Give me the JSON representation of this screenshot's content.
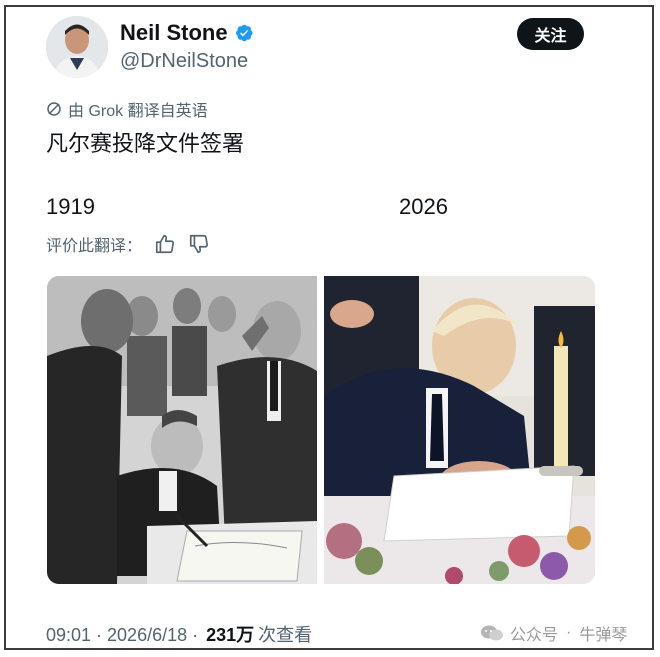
{
  "author": {
    "display_name": "Neil Stone",
    "handle": "@DrNeilStone",
    "verified_icon": "verified-badge-icon"
  },
  "follow_button": {
    "label": "关注"
  },
  "translation": {
    "note": "由 Grok 翻译自英语",
    "text": "凡尔赛投降文件签署",
    "rate_label": "评价此翻译："
  },
  "captions": {
    "left": "1919",
    "right": "2026"
  },
  "media": {
    "left_alt": "1919 illustration",
    "right_alt": "2026 photo"
  },
  "meta": {
    "timestamp": "09:01 · 2026/6/18 ·",
    "view_count": "231万",
    "views_label": "次查看"
  },
  "watermark": {
    "source": "公众号",
    "sep": "·",
    "name": "牛弹琴"
  },
  "colors": {
    "text": "#0f1419",
    "secondary": "#536471",
    "verified": "#1d9bf0",
    "button_bg": "#0f1419"
  }
}
